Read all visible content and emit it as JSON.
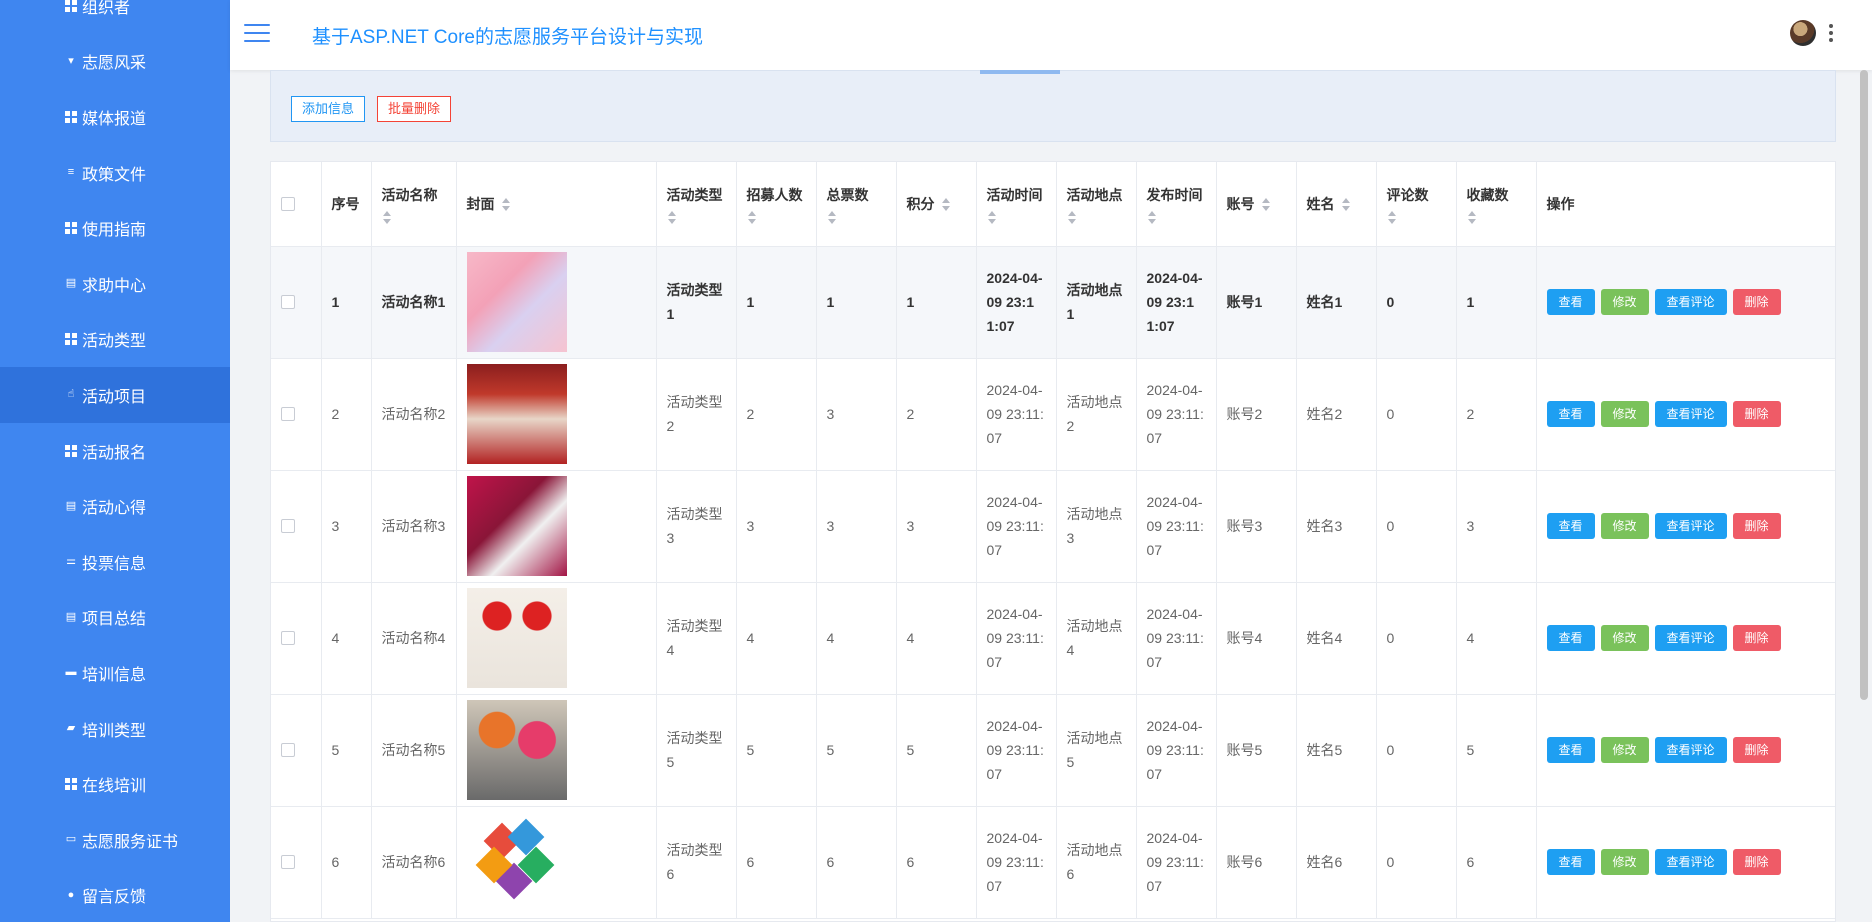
{
  "header": {
    "title": "基于ASP.NET Core的志愿服务平台设计与实现"
  },
  "sidebar": {
    "items": [
      {
        "label": "组织者",
        "icon": "grid-icon"
      },
      {
        "label": "志愿风采",
        "icon": "cup-icon"
      },
      {
        "label": "媒体报道",
        "icon": "grid-icon"
      },
      {
        "label": "政策文件",
        "icon": "list-icon"
      },
      {
        "label": "使用指南",
        "icon": "grid-icon"
      },
      {
        "label": "求助中心",
        "icon": "clipboard-icon"
      },
      {
        "label": "活动类型",
        "icon": "grid-icon"
      },
      {
        "label": "活动项目",
        "icon": "thumbs-up-icon",
        "active": true
      },
      {
        "label": "活动报名",
        "icon": "grid-icon"
      },
      {
        "label": "活动心得",
        "icon": "clipboard-icon"
      },
      {
        "label": "投票信息",
        "icon": "sliders-icon"
      },
      {
        "label": "项目总结",
        "icon": "clipboard-icon"
      },
      {
        "label": "培训信息",
        "icon": "comment-icon"
      },
      {
        "label": "培训类型",
        "icon": "ribbon-icon"
      },
      {
        "label": "在线培训",
        "icon": "grid-icon"
      },
      {
        "label": "志愿服务证书",
        "icon": "certificate-icon"
      },
      {
        "label": "留言反馈",
        "icon": "user-icon"
      }
    ]
  },
  "toolbar": {
    "add_label": "添加信息",
    "batch_delete_label": "批量删除"
  },
  "table": {
    "columns": {
      "index": "序号",
      "name": "活动名称",
      "cover": "封面",
      "type": "活动类型",
      "recruit": "招募人数",
      "votes": "总票数",
      "points": "积分",
      "time": "活动时间",
      "place": "活动地点",
      "publish": "发布时间",
      "account": "账号",
      "realname": "姓名",
      "comments": "评论数",
      "favorites": "收藏数",
      "actions": "操作"
    },
    "actions": {
      "view": "查看",
      "edit": "修改",
      "comments": "查看评论",
      "delete": "删除"
    },
    "rows": [
      {
        "index": "1",
        "name": "活动名称1",
        "cover": "cover-1",
        "type": "活动类型1",
        "recruit": "1",
        "votes": "1",
        "points": "1",
        "time": "2024-04-09 23:11:07",
        "place": "活动地点1",
        "publish": "2024-04-09 23:11:07",
        "account": "账号1",
        "realname": "姓名1",
        "comments": "0",
        "favorites": "1"
      },
      {
        "index": "2",
        "name": "活动名称2",
        "cover": "cover-2",
        "type": "活动类型2",
        "recruit": "2",
        "votes": "3",
        "points": "2",
        "time": "2024-04-09 23:11:07",
        "place": "活动地点2",
        "publish": "2024-04-09 23:11:07",
        "account": "账号2",
        "realname": "姓名2",
        "comments": "0",
        "favorites": "2"
      },
      {
        "index": "3",
        "name": "活动名称3",
        "cover": "cover-3",
        "type": "活动类型3",
        "recruit": "3",
        "votes": "3",
        "points": "3",
        "time": "2024-04-09 23:11:07",
        "place": "活动地点3",
        "publish": "2024-04-09 23:11:07",
        "account": "账号3",
        "realname": "姓名3",
        "comments": "0",
        "favorites": "3"
      },
      {
        "index": "4",
        "name": "活动名称4",
        "cover": "cover-4",
        "type": "活动类型4",
        "recruit": "4",
        "votes": "4",
        "points": "4",
        "time": "2024-04-09 23:11:07",
        "place": "活动地点4",
        "publish": "2024-04-09 23:11:07",
        "account": "账号4",
        "realname": "姓名4",
        "comments": "0",
        "favorites": "4"
      },
      {
        "index": "5",
        "name": "活动名称5",
        "cover": "cover-5",
        "type": "活动类型5",
        "recruit": "5",
        "votes": "5",
        "points": "5",
        "time": "2024-04-09 23:11:07",
        "place": "活动地点5",
        "publish": "2024-04-09 23:11:07",
        "account": "账号5",
        "realname": "姓名5",
        "comments": "0",
        "favorites": "5"
      },
      {
        "index": "6",
        "name": "活动名称6",
        "cover": "cover-6",
        "type": "活动类型6",
        "recruit": "6",
        "votes": "6",
        "points": "6",
        "time": "2024-04-09 23:11:07",
        "place": "活动地点6",
        "publish": "2024-04-09 23:11:07",
        "account": "账号6",
        "realname": "姓名6",
        "comments": "0",
        "favorites": "6"
      }
    ]
  },
  "colors": {
    "sidebar_bg": "#3f86f0",
    "sidebar_active": "#2f72dc",
    "title": "#1e90ff",
    "view_btn": "#1e9ff2",
    "edit_btn": "#7ac25b",
    "delete_btn": "#ef5b67"
  }
}
